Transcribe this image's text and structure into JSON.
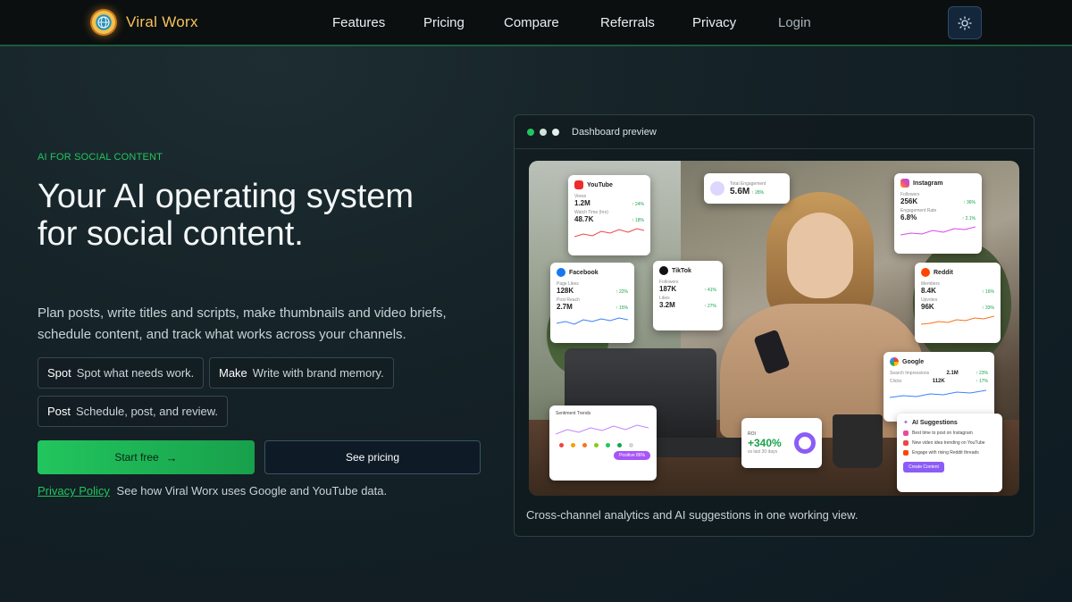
{
  "nav": {
    "brand": "Viral Worx",
    "links": [
      "Features",
      "Pricing",
      "Compare",
      "Referrals",
      "Privacy"
    ],
    "login": "Login",
    "theme_icon": "sun-icon"
  },
  "hero": {
    "eyebrow": "AI FOR SOCIAL CONTENT",
    "title": "Your AI operating system for social content.",
    "subtitle": "Plan posts, write titles and scripts, make thumbnails and video briefs, schedule content, and track what works across your channels.",
    "chips": [
      {
        "key": "Spot",
        "text": "Spot what needs work."
      },
      {
        "key": "Make",
        "text": "Write with brand memory."
      },
      {
        "key": "Post",
        "text": "Schedule, post, and review."
      }
    ],
    "cta_primary": "Start free",
    "cta_secondary": "See pricing",
    "privacy_link": "Privacy Policy",
    "privacy_text": "See how Viral Worx uses Google and YouTube data."
  },
  "preview": {
    "title": "Dashboard preview",
    "caption": "Cross-channel analytics and AI suggestions in one working view.",
    "dots": [
      "#22c55e",
      "#cfe3d7",
      "#e6eee9"
    ],
    "cards": {
      "youtube": {
        "name": "YouTube",
        "l1": "Views",
        "v1": "1.2M",
        "c1": "↑ 24%",
        "l2": "Watch Time (hrs)",
        "v2": "48.7K",
        "c2": "↑ 18%"
      },
      "engagement": {
        "label": "Total Engagement",
        "value": "5.6M",
        "change": "↑ 28%"
      },
      "instagram": {
        "name": "Instagram",
        "l1": "Followers",
        "v1": "256K",
        "c1": "↑ 36%",
        "l2": "Engagement Rate",
        "v2": "6.8%",
        "c2": "↑ 2.1%"
      },
      "facebook": {
        "name": "Facebook",
        "l1": "Page Likes",
        "v1": "128K",
        "c1": "↑ 22%",
        "l2": "Post Reach",
        "v2": "2.7M",
        "c2": "↑ 15%"
      },
      "tiktok": {
        "name": "TikTok",
        "l1": "Followers",
        "v1": "187K",
        "c1": "↑ 41%",
        "l2": "Likes",
        "v2": "3.2M",
        "c2": "↑ 27%"
      },
      "reddit": {
        "name": "Reddit",
        "l1": "Members",
        "v1": "8.4K",
        "c1": "↑ 16%",
        "l2": "Upvotes",
        "v2": "96K",
        "c2": "↑ 33%"
      },
      "google": {
        "name": "Google",
        "l1": "Search Impressions",
        "v1": "2.1M",
        "c1": "↑ 23%",
        "l2": "Clicks",
        "v2": "112K",
        "c2": "↑ 17%"
      },
      "sentiment": {
        "title": "Sentiment Trends",
        "tag": "Positive 86%"
      },
      "roi": {
        "label": "ROI",
        "value": "+340%",
        "sub": "vs last 30 days"
      },
      "ai": {
        "title": "AI Suggestions",
        "items": [
          "Best time to post on Instagram",
          "New video idea trending on YouTube",
          "Engage with rising Reddit threads"
        ],
        "button": "Create Content"
      }
    }
  }
}
